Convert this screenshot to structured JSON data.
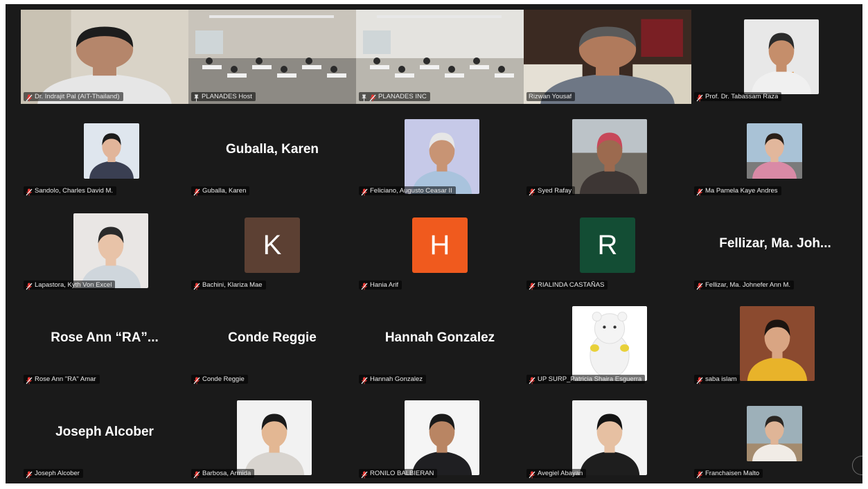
{
  "participants": [
    {
      "name": "Dr. Indrajit Pal (AIT-Thailand)",
      "type": "video",
      "muted": true,
      "pinned": false,
      "active": true
    },
    {
      "name": "PLANADES Host",
      "type": "video",
      "muted": false,
      "pinned": true,
      "active": false
    },
    {
      "name": "PLANADES INC",
      "type": "video",
      "muted": true,
      "pinned": true,
      "active": false
    },
    {
      "name": "Rizwan Yousaf",
      "type": "video",
      "muted": false,
      "pinned": false,
      "active": false
    },
    {
      "name": "Prof. Dr. Tabassam Raza",
      "type": "photo",
      "muted": true,
      "pinned": false,
      "active": false
    },
    {
      "name": "Sandolo, Charles David M.",
      "type": "photo",
      "muted": true,
      "pinned": false,
      "active": false
    },
    {
      "name": "Guballa, Karen",
      "type": "name",
      "display": "Guballa, Karen",
      "muted": true,
      "pinned": false,
      "active": false
    },
    {
      "name": "Feliciano, Augusto Ceasar II",
      "type": "photo",
      "muted": true,
      "pinned": false,
      "active": false
    },
    {
      "name": "Syed Rafay",
      "type": "photo",
      "muted": true,
      "pinned": false,
      "active": false
    },
    {
      "name": "Ma Pamela Kaye Andres",
      "type": "photo",
      "muted": true,
      "pinned": false,
      "active": false
    },
    {
      "name": "Lapastora, Kyth Von Excel",
      "type": "photo",
      "muted": true,
      "pinned": false,
      "active": false
    },
    {
      "name": "Bachini, Klariza Mae",
      "type": "letter",
      "letter": "K",
      "color": "#5c4033",
      "muted": true,
      "pinned": false,
      "active": false
    },
    {
      "name": "Hania Arif",
      "type": "letter",
      "letter": "H",
      "color": "#f05a1e",
      "muted": true,
      "pinned": false,
      "active": false
    },
    {
      "name": "RIALINDA CASTAÑAS",
      "type": "letter",
      "letter": "R",
      "color": "#134d34",
      "muted": true,
      "pinned": false,
      "active": false
    },
    {
      "name": "Fellizar, Ma. Johnefer Ann M.",
      "type": "name",
      "display": "Fellizar,  Ma. Joh...",
      "muted": true,
      "pinned": false,
      "active": false
    },
    {
      "name": "Rose Ann \"RA\" Amar",
      "type": "name",
      "display": "Rose Ann “RA”...",
      "muted": true,
      "pinned": false,
      "active": false
    },
    {
      "name": "Conde Reggie",
      "type": "name",
      "display": "Conde Reggie",
      "muted": true,
      "pinned": false,
      "active": false
    },
    {
      "name": "Hannah Gonzalez",
      "type": "name",
      "display": "Hannah Gonzalez",
      "muted": true,
      "pinned": false,
      "active": false
    },
    {
      "name": "UP SURP_Patricia Shaira Esguerra",
      "type": "photo",
      "muted": true,
      "pinned": false,
      "active": false
    },
    {
      "name": "saba islam",
      "type": "photo",
      "muted": true,
      "pinned": false,
      "active": false
    },
    {
      "name": "Joseph Alcober",
      "type": "name",
      "display": "Joseph Alcober",
      "muted": true,
      "pinned": false,
      "active": false
    },
    {
      "name": "Barbosa, Armida",
      "type": "photo",
      "muted": true,
      "pinned": false,
      "active": false
    },
    {
      "name": "RONILO BALBIERAN",
      "type": "photo",
      "muted": true,
      "pinned": false,
      "active": false
    },
    {
      "name": "Avegiel Abayan",
      "type": "photo",
      "muted": true,
      "pinned": false,
      "active": false
    },
    {
      "name": "Franchaisen Malto",
      "type": "photo",
      "muted": true,
      "pinned": false,
      "active": false
    }
  ],
  "colors": {
    "background": "#1a1a1a",
    "active_speaker_border": "#23d96c",
    "muted_icon": "#e53935"
  }
}
